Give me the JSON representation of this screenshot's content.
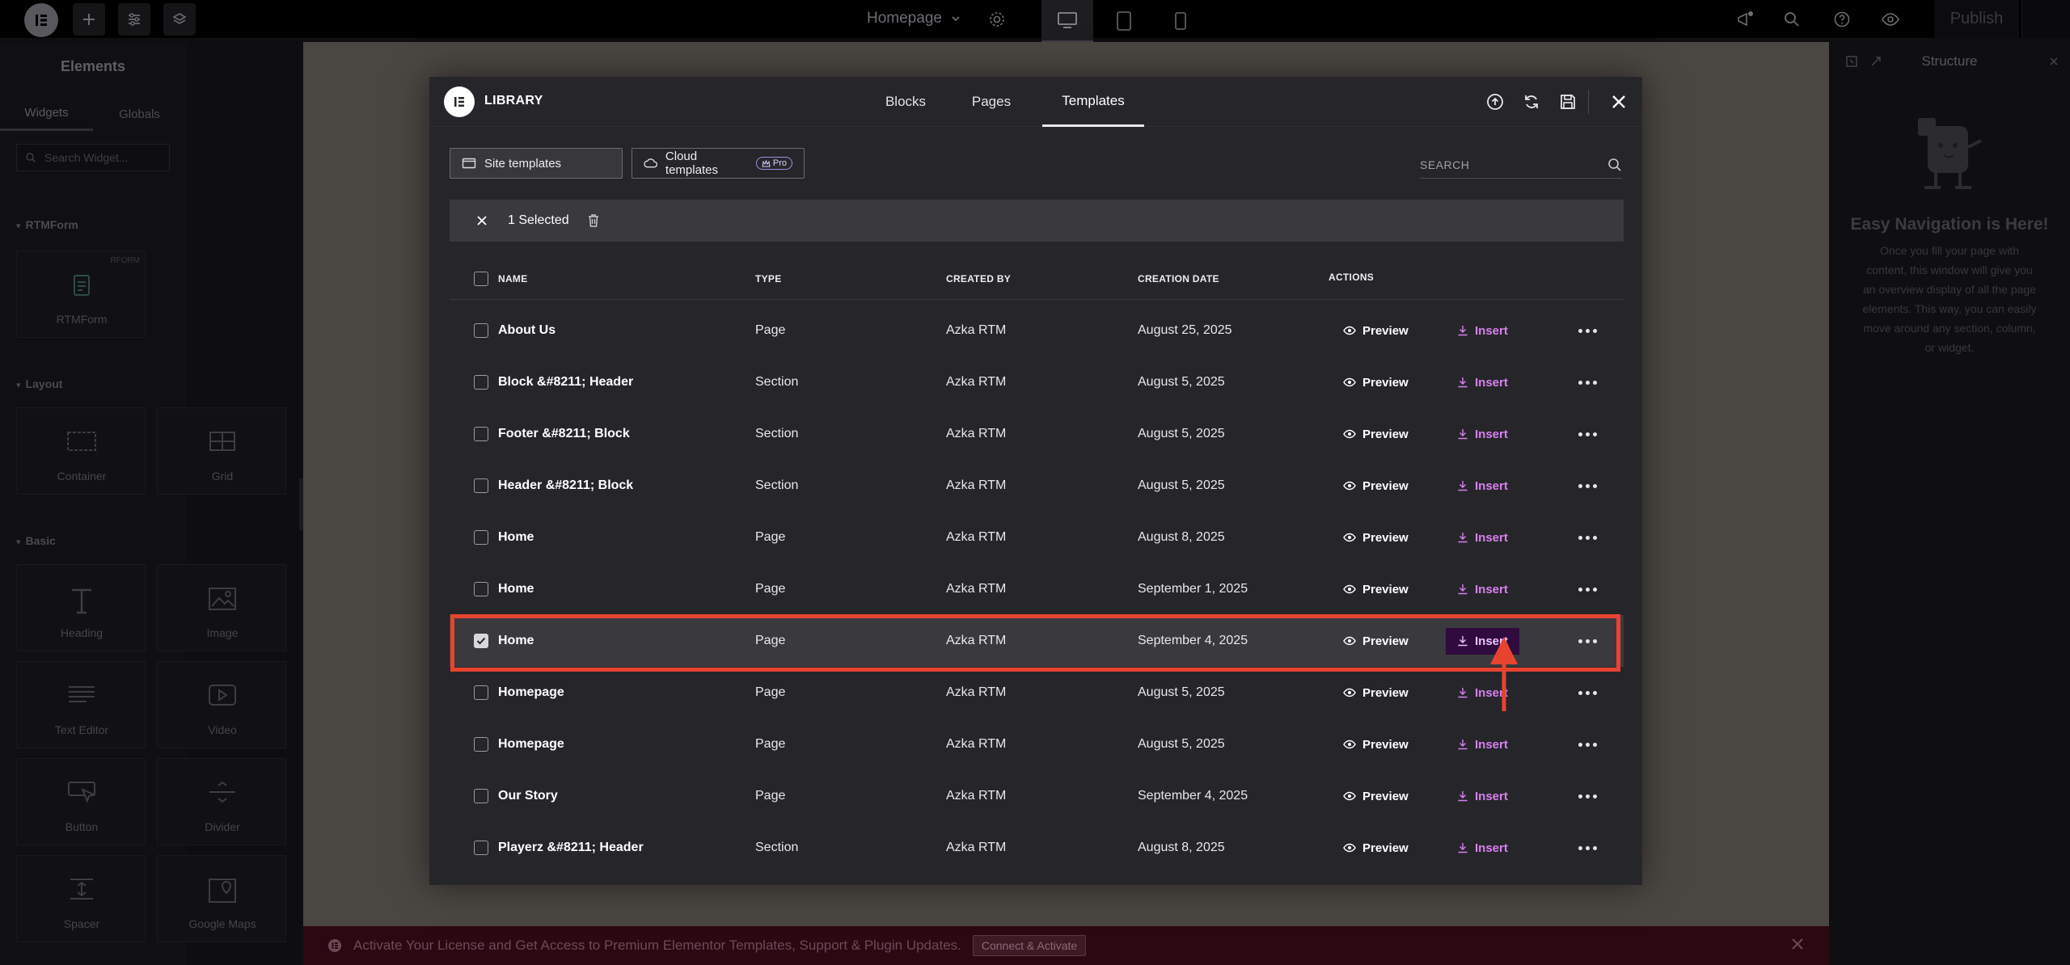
{
  "topbar": {
    "page_title": "Homepage",
    "publish_label": "Publish"
  },
  "left_panel": {
    "title": "Elements",
    "tabs": [
      "Widgets",
      "Globals"
    ],
    "search_placeholder": "Search Widget...",
    "sections": {
      "rtmform": "RTMForm",
      "layout": "Layout",
      "basic": "Basic"
    },
    "widgets": {
      "rtmform": "RTMForm",
      "rtmform_badge": "RFORM",
      "container": "Container",
      "grid": "Grid",
      "heading": "Heading",
      "image": "Image",
      "text_editor": "Text Editor",
      "video": "Video",
      "button": "Button",
      "divider": "Divider",
      "spacer": "Spacer",
      "google_maps": "Google Maps"
    }
  },
  "right_panel": {
    "title": "Structure",
    "heading": "Easy Navigation is Here!",
    "text": "Once you fill your page with content, this window will give you an overview display of all the page elements. This way, you can easily move around any section, column, or widget."
  },
  "bottom_bar": {
    "message": "Activate Your License and Get Access to Premium Elementor Templates, Support & Plugin Updates.",
    "button": "Connect & Activate"
  },
  "library": {
    "brand": "LIBRARY",
    "tabs": [
      "Blocks",
      "Pages",
      "Templates"
    ],
    "active_tab": "Templates",
    "filters": {
      "site": "Site templates",
      "cloud": "Cloud templates",
      "pro": "Pro"
    },
    "search_placeholder": "SEARCH",
    "selection": "1 Selected",
    "columns": {
      "name": "NAME",
      "type": "TYPE",
      "created_by": "CREATED BY",
      "creation_date": "CREATION DATE",
      "actions": "ACTIONS"
    },
    "preview_label": "Preview",
    "insert_label": "Insert",
    "rows": [
      {
        "name": "About Us",
        "type": "Page",
        "author": "Azka RTM",
        "date": "August 25, 2025"
      },
      {
        "name": "Block &#8211; Header",
        "type": "Section",
        "author": "Azka RTM",
        "date": "August 5, 2025"
      },
      {
        "name": "Footer &#8211; Block",
        "type": "Section",
        "author": "Azka RTM",
        "date": "August 5, 2025"
      },
      {
        "name": "Header &#8211; Block",
        "type": "Section",
        "author": "Azka RTM",
        "date": "August 5, 2025"
      },
      {
        "name": "Home",
        "type": "Page",
        "author": "Azka RTM",
        "date": "August 8, 2025"
      },
      {
        "name": "Home",
        "type": "Page",
        "author": "Azka RTM",
        "date": "September 1, 2025"
      },
      {
        "name": "Home",
        "type": "Page",
        "author": "Azka RTM",
        "date": "September 4, 2025"
      },
      {
        "name": "Homepage",
        "type": "Page",
        "author": "Azka RTM",
        "date": "August 5, 2025"
      },
      {
        "name": "Homepage",
        "type": "Page",
        "author": "Azka RTM",
        "date": "August 5, 2025"
      },
      {
        "name": "Our Story",
        "type": "Page",
        "author": "Azka RTM",
        "date": "September 4, 2025"
      },
      {
        "name": "Playerz &#8211; Header",
        "type": "Section",
        "author": "Azka RTM",
        "date": "August 8, 2025"
      }
    ],
    "selected_row": 6
  },
  "colors": {
    "highlight": "#e8432f",
    "insert": "#d880f0",
    "insert_active_bg": "#2f0b3e"
  }
}
